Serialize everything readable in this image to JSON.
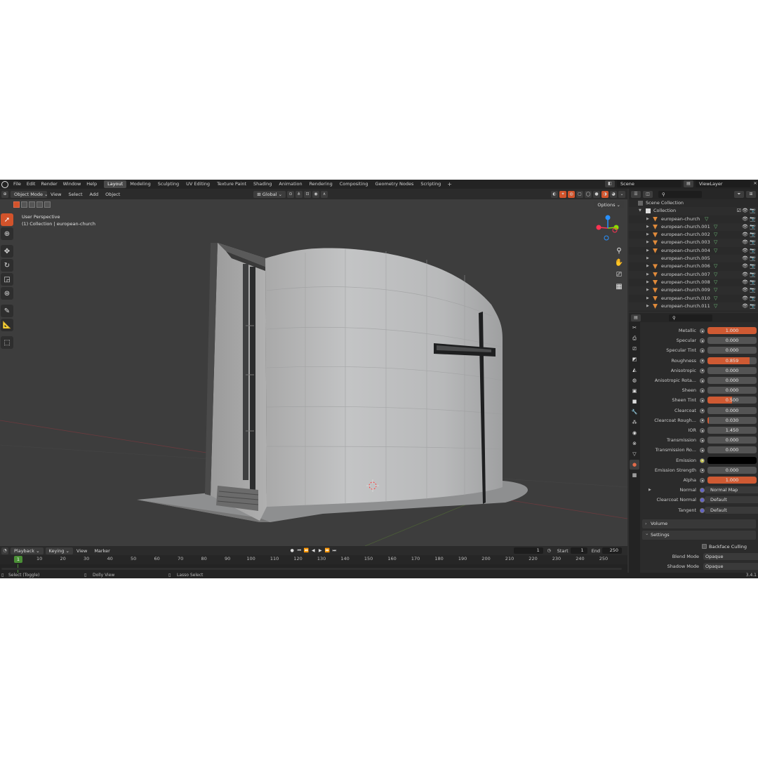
{
  "topbar": {
    "menus": [
      "File",
      "Edit",
      "Render",
      "Window",
      "Help"
    ],
    "workspaces": [
      "Layout",
      "Modeling",
      "Sculpting",
      "UV Editing",
      "Texture Paint",
      "Shading",
      "Animation",
      "Rendering",
      "Compositing",
      "Geometry Nodes",
      "Scripting"
    ],
    "active_workspace": "Layout",
    "plus": "+",
    "scene": "Scene",
    "view_layer": "ViewLayer"
  },
  "viewport_header": {
    "mode": "Object Mode",
    "menus": [
      "View",
      "Select",
      "Add",
      "Object"
    ],
    "transform": "Global"
  },
  "viewport": {
    "perspective": "User Perspective",
    "collection_info": "(1) Collection | european-church",
    "options": "Options"
  },
  "outliner": {
    "scene_collection": "Scene Collection",
    "collection": "Collection",
    "objects": [
      "european-church",
      "european-church.001",
      "european-church.002",
      "european-church.003",
      "european-church.004",
      "european-church.005",
      "european-church.006",
      "european-church.007",
      "european-church.008",
      "european-church.009",
      "european-church.010",
      "european-church.011"
    ]
  },
  "properties": {
    "rows": [
      {
        "label": "Metallic",
        "value": "1.000",
        "fill": 1.0
      },
      {
        "label": "Specular",
        "value": "0.000",
        "fill": 0
      },
      {
        "label": "Specular Tint",
        "value": "0.000",
        "fill": 0
      },
      {
        "label": "Roughness",
        "value": "0.859",
        "fill": 0.859
      },
      {
        "label": "Anisotropic",
        "value": "0.000",
        "fill": 0
      },
      {
        "label": "Anisotropic Rota...",
        "value": "0.000",
        "fill": 0
      },
      {
        "label": "Sheen",
        "value": "0.000",
        "fill": 0
      },
      {
        "label": "Sheen Tint",
        "value": "0.500",
        "fill": 0.5
      },
      {
        "label": "Clearcoat",
        "value": "0.000",
        "fill": 0
      },
      {
        "label": "Clearcoat Rough...",
        "value": "0.030",
        "fill": 0.03
      },
      {
        "label": "IOR",
        "value": "1.450",
        "fill": 0
      },
      {
        "label": "Transmission",
        "value": "0.000",
        "fill": 0
      },
      {
        "label": "Transmission Ro...",
        "value": "0.000",
        "fill": 0
      },
      {
        "label": "Emission",
        "value": "",
        "fill": 0
      },
      {
        "label": "Emission Strength",
        "value": "0.000",
        "fill": 0
      },
      {
        "label": "Alpha",
        "value": "1.000",
        "fill": 1.0
      }
    ],
    "links": [
      {
        "label": "Normal",
        "value": "Normal Map"
      },
      {
        "label": "Clearcoat Normal",
        "value": "Default"
      },
      {
        "label": "Tangent",
        "value": "Default"
      }
    ],
    "volume": "Volume",
    "settings": "Settings",
    "backface_culling": "Backface Culling",
    "blend_mode_label": "Blend Mode",
    "blend_mode": "Opaque",
    "shadow_mode_label": "Shadow Mode",
    "shadow_mode": "Opaque"
  },
  "timeline": {
    "menus": [
      "Playback",
      "Keying",
      "View",
      "Marker"
    ],
    "current_frame": "1",
    "start_label": "Start",
    "start": "1",
    "end_label": "End",
    "end": "250",
    "ruler_current": "1",
    "ticks": [
      "10",
      "20",
      "30",
      "40",
      "50",
      "60",
      "70",
      "80",
      "90",
      "100",
      "110",
      "120",
      "130",
      "140",
      "150",
      "160",
      "170",
      "180",
      "190",
      "200",
      "210",
      "220",
      "230",
      "240",
      "250"
    ]
  },
  "statusbar": {
    "select": "Select (Toggle)",
    "dolly": "Dolly View",
    "lasso": "Lasso Select",
    "version": "3.4.1"
  },
  "colors": {
    "accent": "#d2532b",
    "frame_green": "#4a8f36",
    "axis_red": "#ff3352",
    "axis_green": "#8bdc00",
    "axis_blue": "#2890ff"
  }
}
